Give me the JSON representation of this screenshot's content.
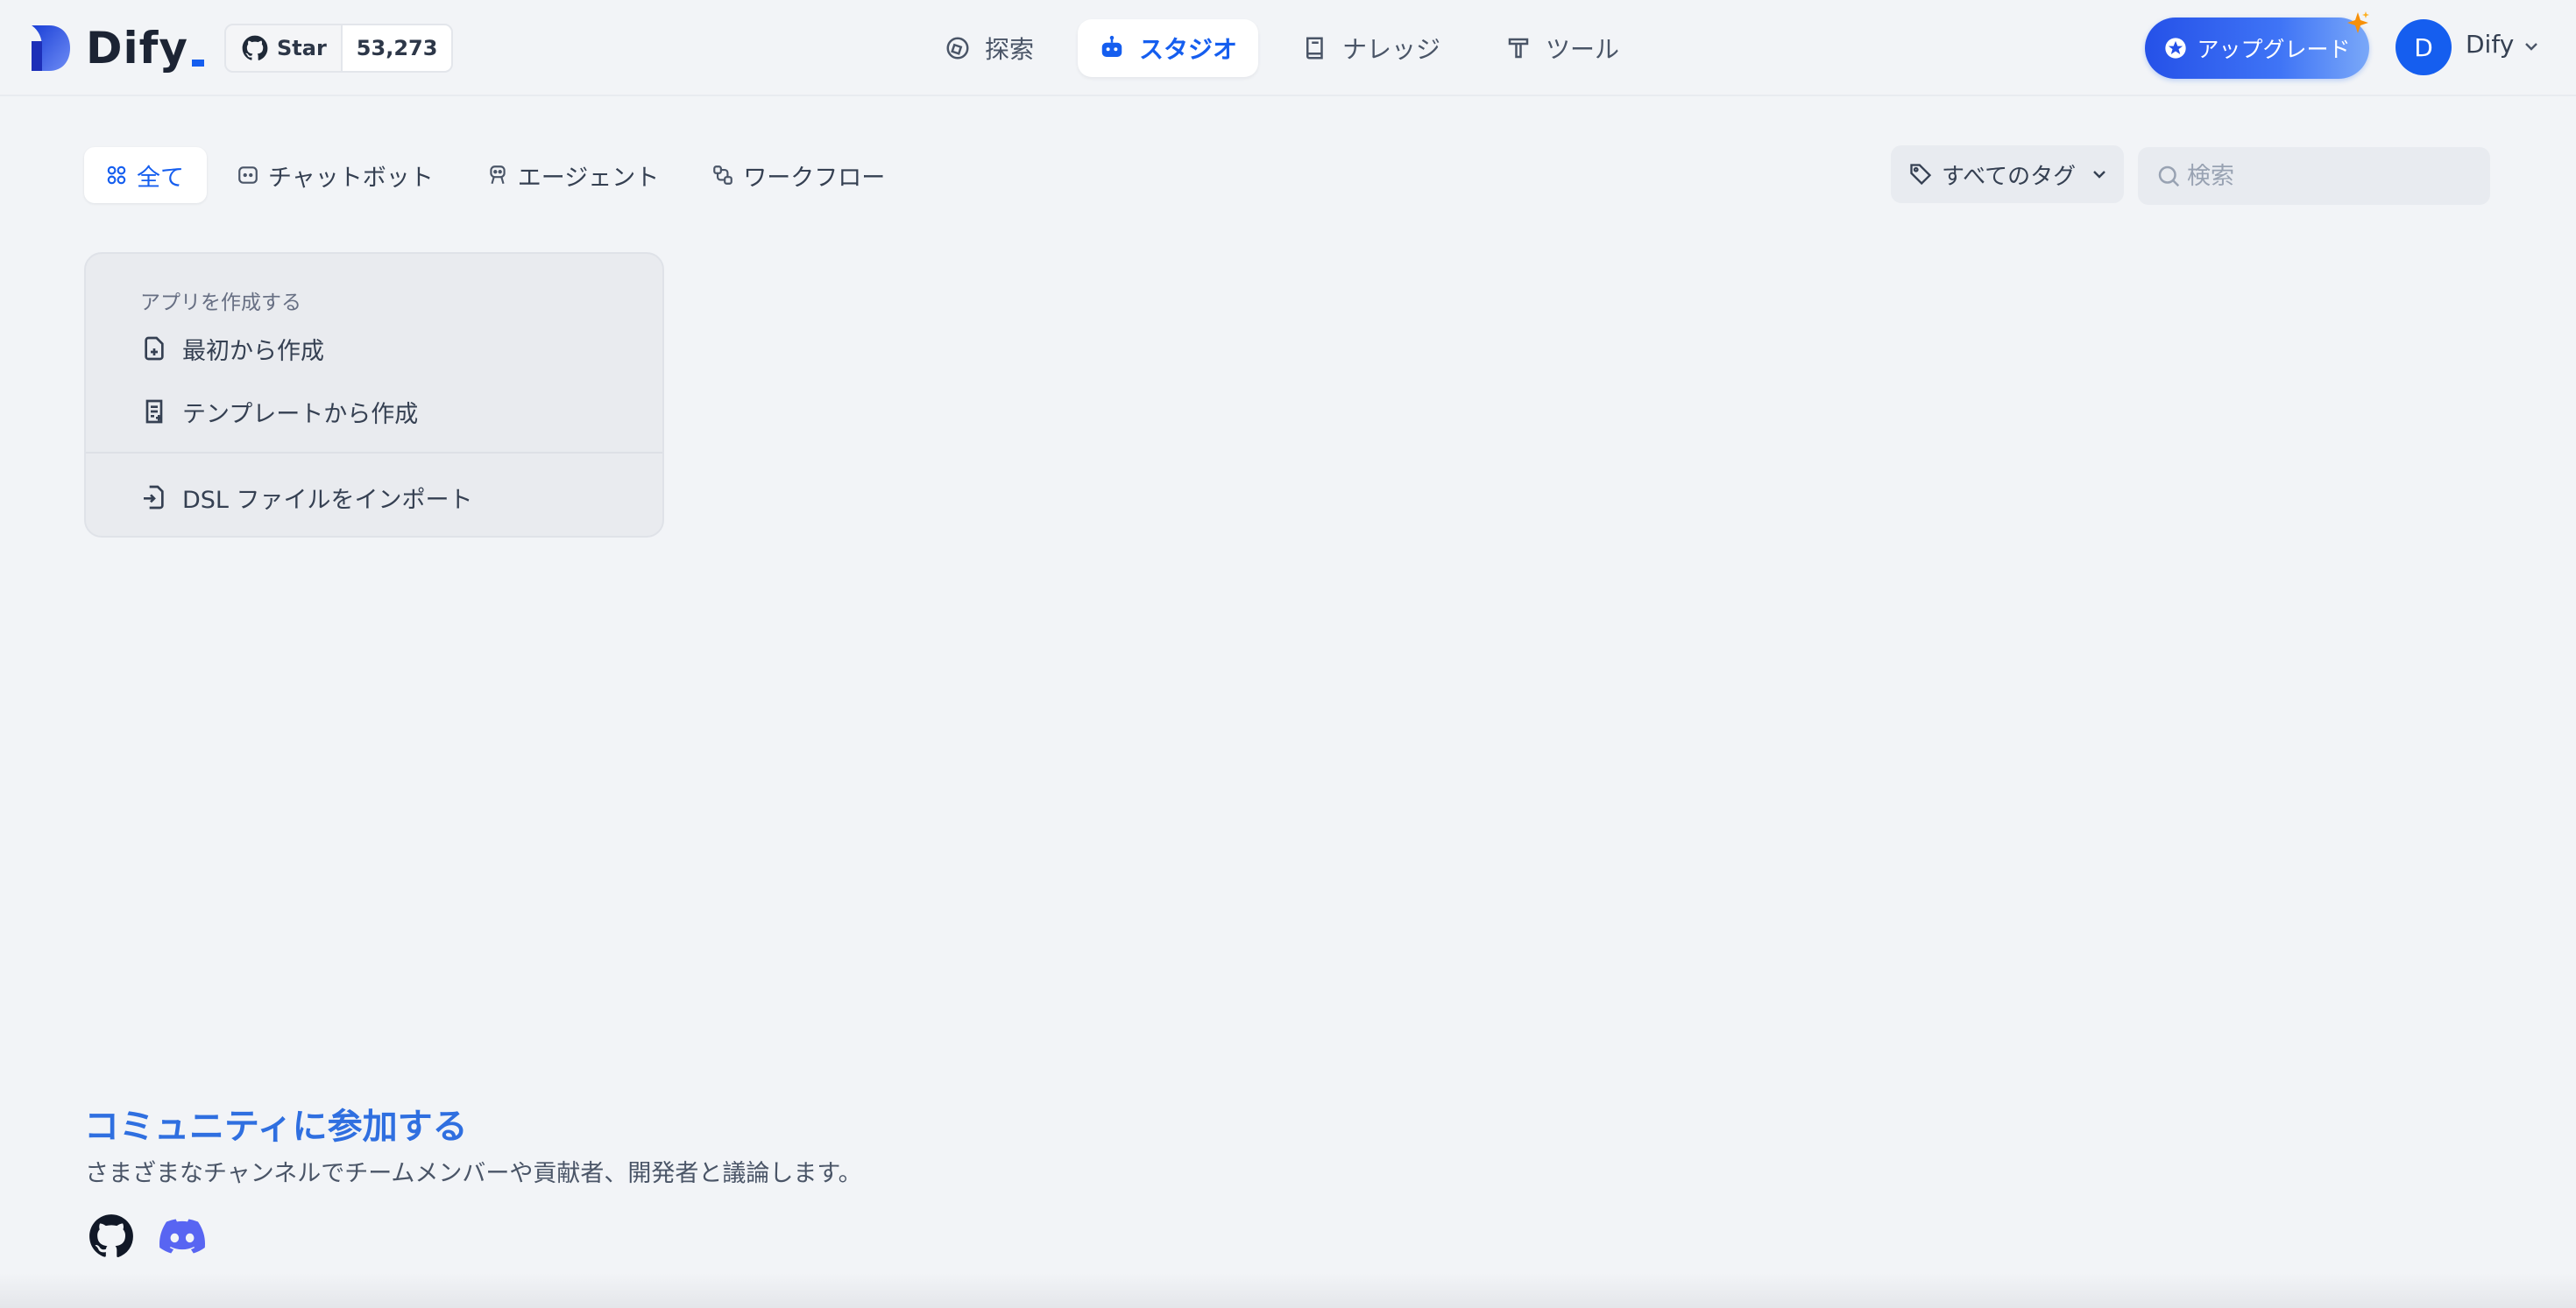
{
  "header": {
    "logo_text": "Dify",
    "github": {
      "star_label": "Star",
      "star_count": "53,273"
    },
    "nav": [
      {
        "label": "探索",
        "icon": "compass-icon",
        "active": false
      },
      {
        "label": "スタジオ",
        "icon": "robot-icon",
        "active": true
      },
      {
        "label": "ナレッジ",
        "icon": "book-icon",
        "active": false
      },
      {
        "label": "ツール",
        "icon": "hammer-icon",
        "active": false
      }
    ],
    "upgrade_label": "アップグレード",
    "account": {
      "initial": "D",
      "name": "Dify"
    }
  },
  "filters": {
    "tabs": [
      {
        "label": "全て",
        "icon": "grid-icon",
        "active": true
      },
      {
        "label": "チャットボット",
        "icon": "chat-bot-icon",
        "active": false
      },
      {
        "label": "エージェント",
        "icon": "agent-icon",
        "active": false
      },
      {
        "label": "ワークフロー",
        "icon": "workflow-icon",
        "active": false
      }
    ],
    "tag_label": "すべてのタグ",
    "search_placeholder": "検索"
  },
  "create_card": {
    "title": "アプリを作成する",
    "items": [
      {
        "label": "最初から作成",
        "icon": "file-plus-icon"
      },
      {
        "label": "テンプレートから作成",
        "icon": "template-icon"
      },
      {
        "label": "DSL ファイルをインポート",
        "icon": "file-import-icon"
      }
    ]
  },
  "community": {
    "title": "コミュニティに参加する",
    "description": "さまざまなチャンネルでチームメンバーや貢献者、開発者と議論します。",
    "links": [
      "github-icon",
      "discord-icon"
    ]
  },
  "colors": {
    "accent": "#155eef",
    "background": "#f2f4f7",
    "community_title": "#2f6fe0",
    "discord": "#5865f2"
  }
}
